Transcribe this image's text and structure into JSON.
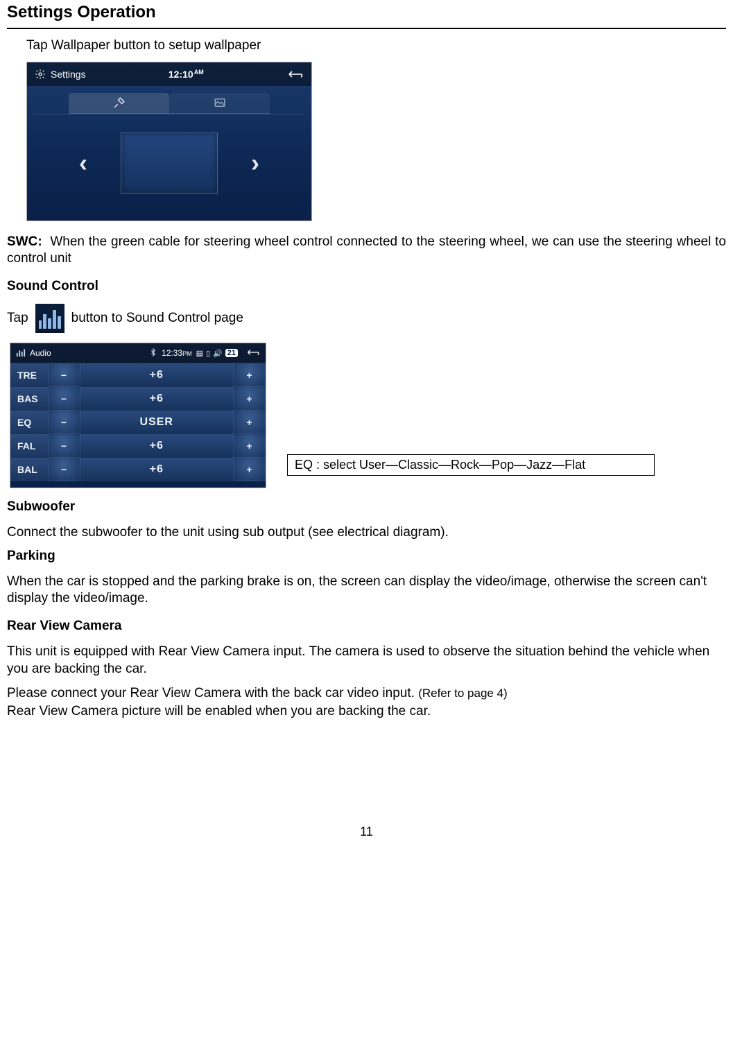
{
  "page_title": "Settings Operation",
  "wallpaper_instruction": "Tap Wallpaper button to setup wallpaper",
  "settings_screen": {
    "title": "Settings",
    "time": "12:10",
    "time_suffix": "AM"
  },
  "swc": {
    "label": "SWC:",
    "text": "When the green cable for steering wheel control connected to the steering wheel, we can use the steering wheel to control unit"
  },
  "sound_control_heading": "Sound Control",
  "sound_tap_prefix": "Tap",
  "sound_tap_suffix": "button to Sound Control page",
  "audio_screen": {
    "title": "Audio",
    "time": "12:33",
    "time_suffix": "PM",
    "volume": "21",
    "rows": [
      {
        "label": "TRE",
        "minus": "−",
        "value": "+6",
        "plus": "+"
      },
      {
        "label": "BAS",
        "minus": "−",
        "value": "+6",
        "plus": "+"
      },
      {
        "label": "EQ",
        "minus": "−",
        "value": "USER",
        "plus": "+"
      },
      {
        "label": "FAL",
        "minus": "−",
        "value": "+6",
        "plus": "+"
      },
      {
        "label": "BAL",
        "minus": "−",
        "value": "+6",
        "plus": "+"
      }
    ]
  },
  "eq_note": "EQ  : select User—Classic—Rock—Pop—Jazz—Flat",
  "subwoofer_heading": "Subwoofer",
  "subwoofer_text": "Connect the subwoofer to the unit using sub output (see electrical diagram).",
  "parking_heading": "Parking",
  "parking_text": "When the car is stopped and the parking brake is on, the screen can display the video/image, otherwise the screen can't display the video/image.",
  "rear_heading": "Rear View Camera",
  "rear_p1": "This unit is equipped with Rear View Camera input. The camera is used to observe the situation behind the vehicle when you are backing the car.",
  "rear_p2_a": "Please connect your Rear View Camera with the back car video input. ",
  "rear_p2_b": "(Refer to page 4)",
  "rear_p3": "Rear View Camera picture will be enabled when you are backing the car.",
  "page_number": "11"
}
